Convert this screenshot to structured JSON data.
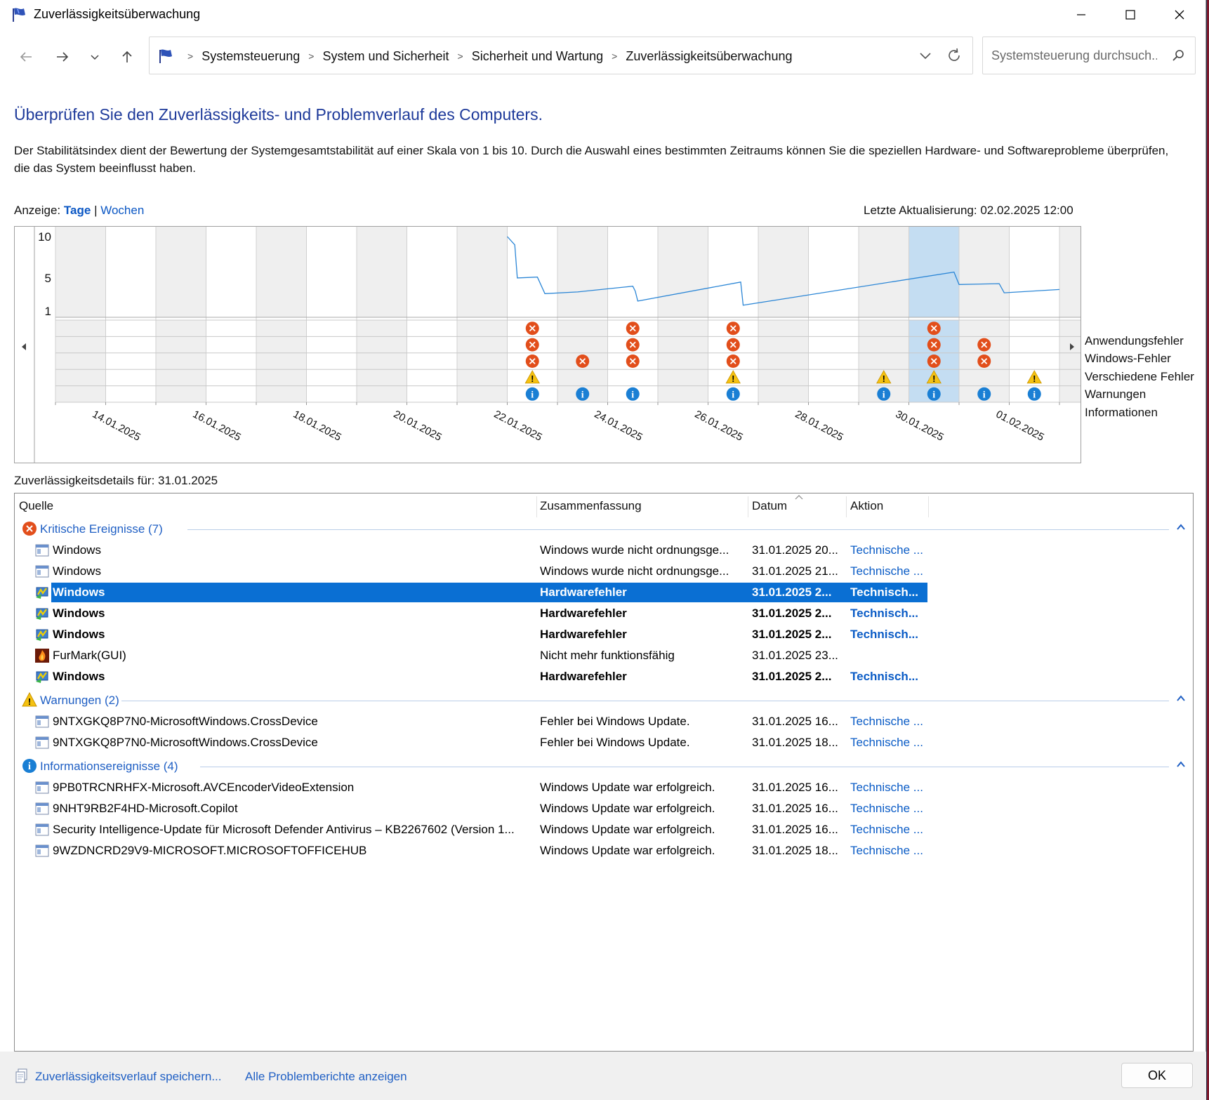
{
  "window": {
    "title": "Zuverlässigkeitsüberwachung"
  },
  "breadcrumb": [
    "Systemsteuerung",
    "System und Sicherheit",
    "Sicherheit und Wartung",
    "Zuverlässigkeitsüberwachung"
  ],
  "search": {
    "placeholder": "Systemsteuerung durchsuch..."
  },
  "heading": "Überprüfen Sie den Zuverlässigkeits- und Problemverlauf des Computers.",
  "description": "Der Stabilitätsindex dient der Bewertung der Systemgesamtstabilität auf einer Skala von 1 bis 10. Durch die Auswahl eines bestimmten Zeitraums können Sie die speziellen Hardware- und Softwareprobleme überprüfen, die das System beeinflusst haben.",
  "view": {
    "label": "Anzeige:",
    "days": "Tage",
    "separator": "|",
    "weeks": "Wochen",
    "active": "days"
  },
  "last_update": "Letzte Aktualisierung: 02.02.2025 12:00",
  "chart": {
    "y_ticks": [
      "10",
      "5",
      "1"
    ],
    "x_labels": [
      "14.01.2025",
      "16.01.2025",
      "18.01.2025",
      "20.01.2025",
      "22.01.2025",
      "24.01.2025",
      "26.01.2025",
      "28.01.2025",
      "30.01.2025",
      "01.02.2025"
    ],
    "legend": [
      "Anwendungsfehler",
      "Windows-Fehler",
      "Verschiedene Fehler",
      "Warnungen",
      "Informationen"
    ],
    "selected_day": 17,
    "colors": {
      "line": "#2b86d6",
      "selected": "#c4ddf2",
      "shade": "#efefef",
      "error": "#e24e1b",
      "warning": "#f5c211",
      "info": "#1a7fd4"
    }
  },
  "chart_data": {
    "type": "line",
    "days": [
      "13.01.2025",
      "14.01.2025",
      "15.01.2025",
      "16.01.2025",
      "17.01.2025",
      "18.01.2025",
      "19.01.2025",
      "20.01.2025",
      "21.01.2025",
      "22.01.2025",
      "23.01.2025",
      "24.01.2025",
      "25.01.2025",
      "26.01.2025",
      "27.01.2025",
      "28.01.2025",
      "29.01.2025",
      "30.01.2025",
      "31.01.2025",
      "01.02.2025",
      "02.02.2025"
    ],
    "stability_index": [
      {
        "day": 9.0,
        "value": 10
      },
      {
        "day": 9.15,
        "value": 9.0
      },
      {
        "day": 9.2,
        "value": 5.0
      },
      {
        "day": 9.6,
        "value": 5.1
      },
      {
        "day": 9.75,
        "value": 3.1
      },
      {
        "day": 10.4,
        "value": 3.3
      },
      {
        "day": 11.5,
        "value": 4.0
      },
      {
        "day": 11.55,
        "value": 3.4
      },
      {
        "day": 11.6,
        "value": 2.2
      },
      {
        "day": 13.65,
        "value": 4.5
      },
      {
        "day": 13.7,
        "value": 1.7
      },
      {
        "day": 17.9,
        "value": 5.7
      },
      {
        "day": 18.0,
        "value": 4.2
      },
      {
        "day": 18.8,
        "value": 4.3
      },
      {
        "day": 18.9,
        "value": 3.2
      },
      {
        "day": 20.0,
        "value": 3.6
      }
    ],
    "events": {
      "Anwendungsfehler": [
        9,
        11,
        13,
        17
      ],
      "Windows-Fehler": [
        9,
        11,
        13,
        17,
        18
      ],
      "Verschiedene Fehler": [
        9,
        10,
        11,
        13,
        17,
        18
      ],
      "Warnungen": [
        9,
        13,
        16,
        17,
        19
      ],
      "Informationen": [
        9,
        10,
        11,
        13,
        16,
        17,
        18,
        19
      ]
    },
    "ylim": [
      1,
      10
    ]
  },
  "details": {
    "title": "Zuverlässigkeitsdetails für: 31.01.2025",
    "columns": [
      "Quelle",
      "Zusammenfassung",
      "Datum",
      "Aktion"
    ],
    "groups": [
      {
        "label": "Kritische Ereignisse (7)",
        "icon": "error-icon",
        "rows": [
          {
            "src": "Windows",
            "sum": "Windows wurde nicht ordnungsge...",
            "date": "31.01.2025 20...",
            "act": "Technische ...",
            "icon": "app-icon",
            "bold": false
          },
          {
            "src": "Windows",
            "sum": "Windows wurde nicht ordnungsge...",
            "date": "31.01.2025 21...",
            "act": "Technische ...",
            "icon": "app-icon",
            "bold": false
          },
          {
            "src": "Windows",
            "sum": "Hardwarefehler",
            "date": "31.01.2025 2...",
            "act": "Technisch...",
            "icon": "hardware-icon",
            "bold": true,
            "selected": true
          },
          {
            "src": "Windows",
            "sum": "Hardwarefehler",
            "date": "31.01.2025 2...",
            "act": "Technisch...",
            "icon": "hardware-icon",
            "bold": true
          },
          {
            "src": "Windows",
            "sum": "Hardwarefehler",
            "date": "31.01.2025 2...",
            "act": "Technisch...",
            "icon": "hardware-icon",
            "bold": true
          },
          {
            "src": "FurMark(GUI)",
            "sum": "Nicht mehr funktionsfähig",
            "date": "31.01.2025 23...",
            "act": "",
            "icon": "furmark-icon",
            "bold": false
          },
          {
            "src": "Windows",
            "sum": "Hardwarefehler",
            "date": "31.01.2025 2...",
            "act": "Technisch...",
            "icon": "hardware-icon",
            "bold": true
          }
        ]
      },
      {
        "label": "Warnungen (2)",
        "icon": "warning-icon",
        "rows": [
          {
            "src": "9NTXGKQ8P7N0-MicrosoftWindows.CrossDevice",
            "sum": "Fehler bei Windows Update.",
            "date": "31.01.2025 16...",
            "act": "Technische ...",
            "icon": "app-icon"
          },
          {
            "src": "9NTXGKQ8P7N0-MicrosoftWindows.CrossDevice",
            "sum": "Fehler bei Windows Update.",
            "date": "31.01.2025 18...",
            "act": "Technische ...",
            "icon": "app-icon"
          }
        ]
      },
      {
        "label": "Informationsereignisse (4)",
        "icon": "info-icon",
        "rows": [
          {
            "src": "9PB0TRCNRHFX-Microsoft.AVCEncoderVideoExtension",
            "sum": "Windows Update war erfolgreich.",
            "date": "31.01.2025 16...",
            "act": "Technische ...",
            "icon": "app-icon"
          },
          {
            "src": "9NHT9RB2F4HD-Microsoft.Copilot",
            "sum": "Windows Update war erfolgreich.",
            "date": "31.01.2025 16...",
            "act": "Technische ...",
            "icon": "app-icon"
          },
          {
            "src": "Security Intelligence-Update für Microsoft Defender Antivirus – KB2267602 (Version 1...",
            "sum": "Windows Update war erfolgreich.",
            "date": "31.01.2025 16...",
            "act": "Technische ...",
            "icon": "app-icon"
          },
          {
            "src": "9WZDNCRD29V9-MICROSOFT.MICROSOFTOFFICEHUB",
            "sum": "Windows Update war erfolgreich.",
            "date": "31.01.2025 18...",
            "act": "Technische ...",
            "icon": "app-icon"
          }
        ]
      }
    ]
  },
  "footer": {
    "save_link": "Zuverlässigkeitsverlauf speichern...",
    "all_reports_link": "Alle Problemberichte anzeigen",
    "ok_label": "OK"
  }
}
